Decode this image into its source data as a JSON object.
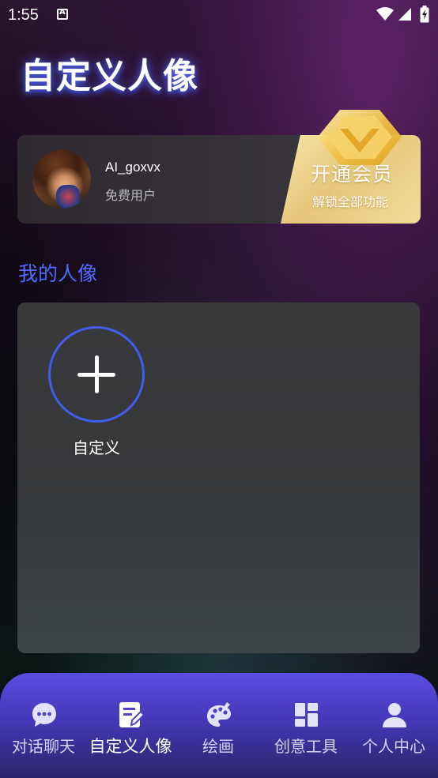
{
  "status_bar": {
    "time": "1:55"
  },
  "page_title": "自定义人像",
  "user": {
    "name": "AI_goxvx",
    "type": "免费用户"
  },
  "vip": {
    "title": "开通会员",
    "subtitle": "解锁全部功能"
  },
  "section": {
    "heading": "我的人像"
  },
  "portraits": {
    "add_label": "自定义"
  },
  "nav": {
    "items": [
      {
        "label": "对话聊天",
        "icon": "chat-bubble-icon",
        "active": false
      },
      {
        "label": "自定义人像",
        "icon": "edit-document-icon",
        "active": true
      },
      {
        "label": "绘画",
        "icon": "palette-icon",
        "active": false
      },
      {
        "label": "创意工具",
        "icon": "dashboard-icon",
        "active": false
      },
      {
        "label": "个人中心",
        "icon": "person-icon",
        "active": false
      }
    ]
  },
  "colors": {
    "accent": "#4f6bff",
    "nav_bg": "#5a4de0",
    "vip_gold": "#e6c77a"
  }
}
